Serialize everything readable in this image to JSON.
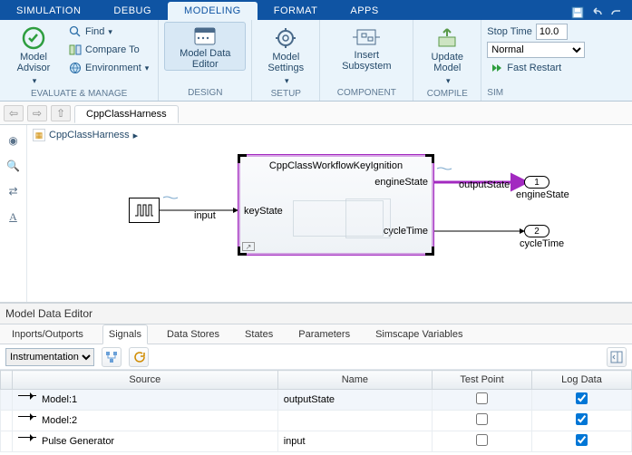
{
  "top_tabs": {
    "simulation": "SIMULATION",
    "debug": "DEBUG",
    "modeling": "MODELING",
    "format": "FORMAT",
    "apps": "APPS"
  },
  "ribbon": {
    "evaluate_manage": {
      "caption": "EVALUATE & MANAGE",
      "model_advisor": "Model\nAdvisor",
      "find": "Find",
      "compare_to": "Compare To",
      "environment": "Environment"
    },
    "design": {
      "caption": "DESIGN",
      "model_data_editor": "Model Data\nEditor"
    },
    "setup": {
      "caption": "SETUP",
      "model_settings": "Model\nSettings"
    },
    "component": {
      "caption": "COMPONENT",
      "insert_subsystem": "Insert\nSubsystem"
    },
    "compile": {
      "caption": "COMPILE",
      "update_model": "Update\nModel"
    },
    "simulate": {
      "caption": "SIM",
      "stop_time_label": "Stop Time",
      "stop_time_value": "10.0",
      "mode": "Normal",
      "fast_restart": "Fast Restart"
    }
  },
  "nav": {
    "tab": "CppClassHarness"
  },
  "canvas": {
    "breadcrumb": "CppClassHarness",
    "input_label": "input",
    "block_title": "CppClassWorkflowKeyIgnition",
    "port_keystate": "keyState",
    "port_enginestate": "engineState",
    "port_cycletime": "cycleTime",
    "sig_outputstate": "outputState",
    "out1_num": "1",
    "out1_label": "engineState",
    "out2_num": "2",
    "out2_label": "cycleTime"
  },
  "mde": {
    "title": "Model Data Editor",
    "tabs": {
      "inports_outports": "Inports/Outports",
      "signals": "Signals",
      "data_stores": "Data Stores",
      "states": "States",
      "parameters": "Parameters",
      "simscape": "Simscape Variables"
    },
    "toolbar": {
      "view": "Instrumentation"
    },
    "columns": {
      "source": "Source",
      "name": "Name",
      "test_point": "Test Point",
      "log_data": "Log Data"
    },
    "rows": [
      {
        "source": "Model:1",
        "name": "outputState",
        "test_point": false,
        "log_data": true,
        "selected": true
      },
      {
        "source": "Model:2",
        "name": "",
        "test_point": false,
        "log_data": true,
        "selected": false
      },
      {
        "source": "Pulse Generator",
        "name": "input",
        "test_point": false,
        "log_data": true,
        "selected": false
      }
    ]
  }
}
